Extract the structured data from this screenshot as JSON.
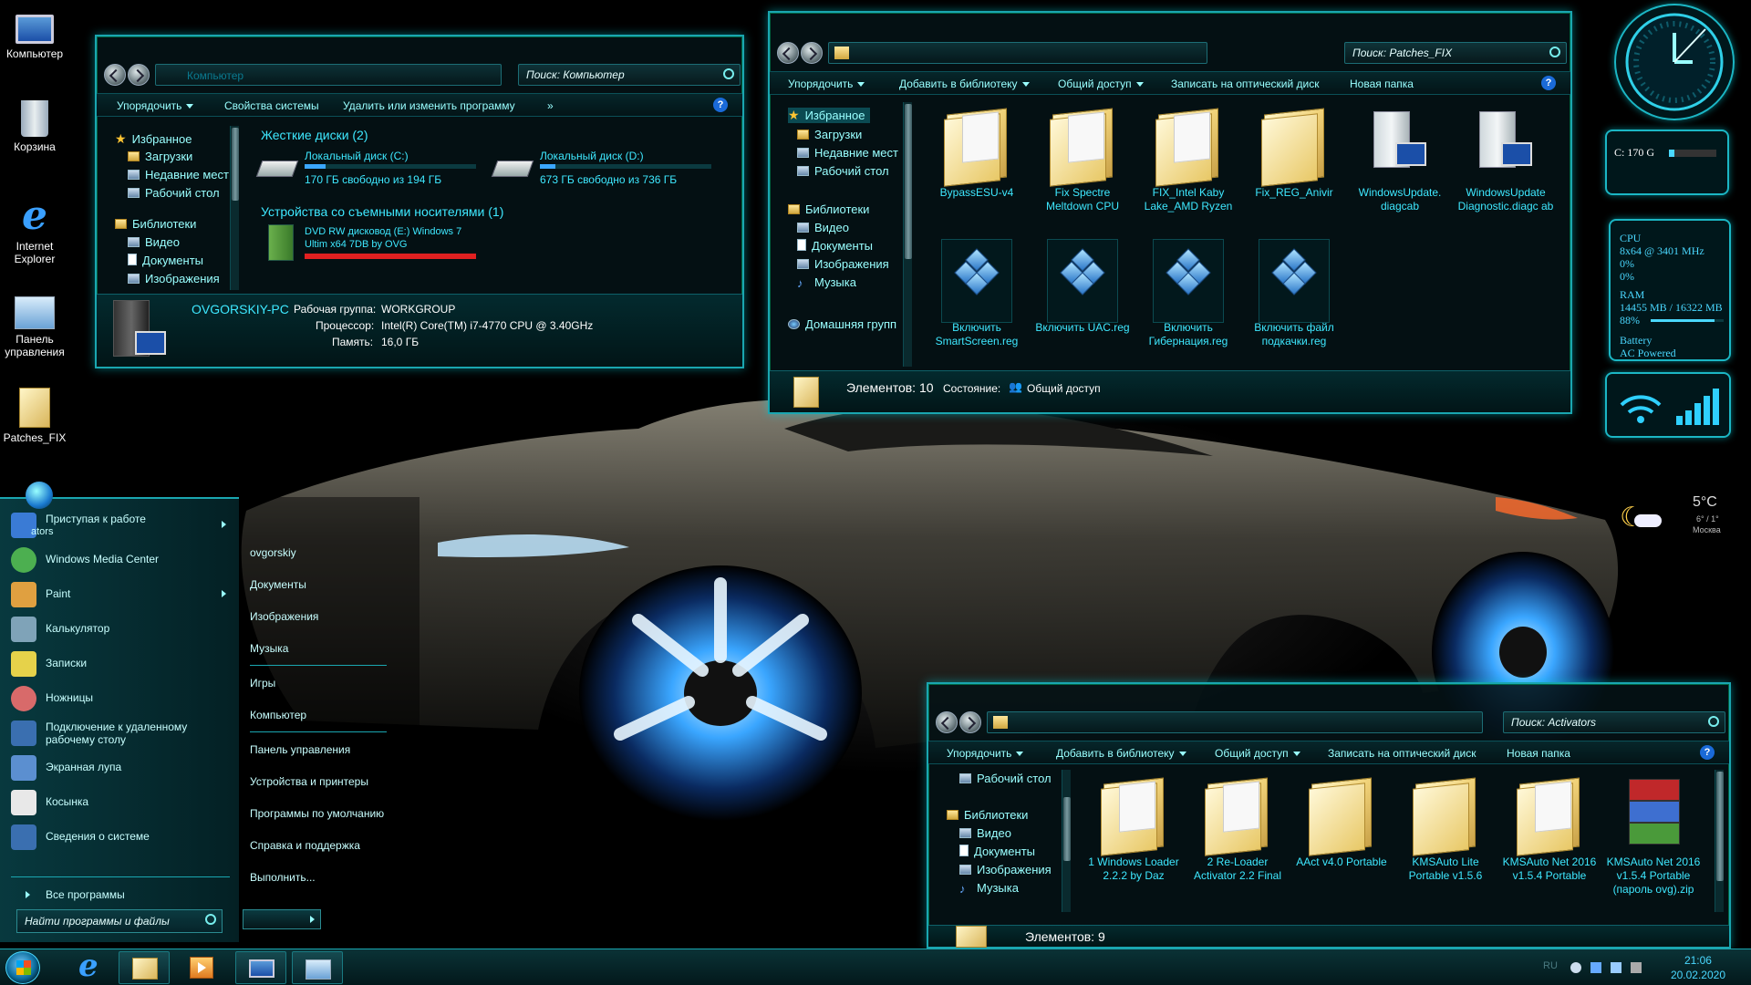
{
  "desktop": {
    "icons": [
      {
        "label": "Компьютер"
      },
      {
        "label": "Корзина"
      },
      {
        "label": "Internet Explorer"
      },
      {
        "label": "Панель управления"
      },
      {
        "label": "Patches_FIX"
      }
    ]
  },
  "computer_window": {
    "address": "Компьютер",
    "search_placeholder": "Поиск: Компьютер",
    "toolbar": {
      "organize": "Упорядочить",
      "system_props": "Свойства системы",
      "uninstall": "Удалить или изменить программу",
      "more": "»"
    },
    "nav": [
      "Избранное",
      "Загрузки",
      "Недавние мест",
      "Рабочий стол",
      "Библиотеки",
      "Видео",
      "Документы",
      "Изображения"
    ],
    "hdd_group": "Жесткие диски (2)",
    "drives": [
      {
        "name": "Локальный диск (C:)",
        "free": "170 ГБ свободно из 194 ГБ",
        "used_fraction": 0.12
      },
      {
        "name": "Локальный диск (D:)",
        "free": "673 ГБ свободно из 736 ГБ",
        "used_fraction": 0.09
      }
    ],
    "removable_group": "Устройства со съемными носителями (1)",
    "dvd": {
      "line1": "DVD RW дисковод (E:) Windows 7",
      "line2": "Ultim x64 7DB by OVG",
      "used_fraction": 1.0
    },
    "details": {
      "pc_name": "OVGORSKIY-PC",
      "workgroup_label": "Рабочая группа:",
      "workgroup": "WORKGROUP",
      "cpu_label": "Процессор:",
      "cpu": "Intel(R) Core(TM) i7-4770 CPU @ 3.40GHz",
      "ram_label": "Память:",
      "ram": "16,0 ГБ"
    }
  },
  "patches_window": {
    "search_placeholder": "Поиск: Patches_FIX",
    "toolbar": {
      "organize": "Упорядочить",
      "add_library": "Добавить в библиотеку",
      "share": "Общий доступ",
      "burn": "Записать на оптический диск",
      "new_folder": "Новая папка"
    },
    "nav": [
      "Избранное",
      "Загрузки",
      "Недавние мест",
      "Рабочий стол",
      "Библиотеки",
      "Видео",
      "Документы",
      "Изображения",
      "Музыка",
      "Домашняя групп"
    ],
    "files": [
      {
        "name": "BypassESU-v4",
        "kind": "folder"
      },
      {
        "name": "Fix Spectre Meltdown CPU",
        "kind": "folder"
      },
      {
        "name": "FIX_Intel Kaby Lake_AMD Ryzen",
        "kind": "folder"
      },
      {
        "name": "Fix_REG_Anivir",
        "kind": "folder"
      },
      {
        "name": "WindowsUpdate. diagcab",
        "kind": "diagcab"
      },
      {
        "name": "WindowsUpdate Diagnostic.diagc ab",
        "kind": "diagcab"
      },
      {
        "name": "Включить SmartScreen.reg",
        "kind": "reg"
      },
      {
        "name": "Включить UAC.reg",
        "kind": "reg"
      },
      {
        "name": "Включить Гибернация.reg",
        "kind": "reg"
      },
      {
        "name": "Включить файл подкачки.reg",
        "kind": "reg"
      }
    ],
    "status": {
      "items": "Элементов: 10",
      "state_label": "Состояние:",
      "state": "Общий доступ"
    }
  },
  "activators_window": {
    "search_placeholder": "Поиск: Activators",
    "toolbar": {
      "organize": "Упорядочить",
      "add_library": "Добавить в библиотеку",
      "share": "Общий доступ",
      "burn": "Записать на оптический диск",
      "new_folder": "Новая папка"
    },
    "nav": [
      "Рабочий стол",
      "Библиотеки",
      "Видео",
      "Документы",
      "Изображения",
      "Музыка"
    ],
    "files": [
      {
        "name": "1 Windows Loader 2.2.2 by Daz",
        "kind": "folder"
      },
      {
        "name": "2 Re-Loader Activator 2.2 Final",
        "kind": "folder"
      },
      {
        "name": "AAct v4.0 Portable",
        "kind": "folder"
      },
      {
        "name": "KMSAuto Lite Portable v1.5.6",
        "kind": "folder"
      },
      {
        "name": "KMSAuto Net 2016 v1.5.4 Portable",
        "kind": "folder"
      },
      {
        "name": "KMSAuto Net 2016 v1.5.4 Portable (пароль ovg).zip",
        "kind": "winrar"
      }
    ],
    "status": {
      "items": "Элементов: 9"
    }
  },
  "start_menu": {
    "programs": [
      {
        "label": "Приступая к работе",
        "sub": "ators",
        "arrow": true,
        "color": "#3a7bd5"
      },
      {
        "label": "Windows Media Center",
        "color": "#4caf50"
      },
      {
        "label": "Paint",
        "arrow": true,
        "color": "#e0a040"
      },
      {
        "label": "Калькулятор",
        "color": "#7fa3b8"
      },
      {
        "label": "Записки",
        "color": "#e6d24a"
      },
      {
        "label": "Ножницы",
        "color": "#d86a6a"
      },
      {
        "label": "Подключение к удаленному",
        "label2": "рабочему столу",
        "color": "#3a6fb0"
      },
      {
        "label": "Экранная лупа",
        "color": "#5b8fd0"
      },
      {
        "label": "Косынка",
        "color": "#e8e8e8"
      },
      {
        "label": "Сведения о системе",
        "color": "#3a6fb0"
      }
    ],
    "all_programs": "Все программы",
    "search_placeholder": "Найти программы и файлы",
    "right_items": [
      "ovgorskiy",
      "Документы",
      "Изображения",
      "Музыка",
      "Игры",
      "Компьютер",
      "Панель управления",
      "Устройства и принтеры",
      "Программы по умолчанию",
      "Справка и поддержка",
      "Выполнить..."
    ]
  },
  "gadgets": {
    "disk": {
      "label": "C: 170 G"
    },
    "cpu": {
      "title": "CPU",
      "freq": "8x64 @ 3401 MHz",
      "core1": "0%",
      "core2": "0%"
    },
    "ram": {
      "title": "RAM",
      "usage": "14455 MB / 16322 MB",
      "percent": "88%",
      "fraction": 0.88
    },
    "battery": {
      "title": "Battery",
      "state": "AC Powered"
    },
    "weather": {
      "temp": "5°C",
      "range": "6° / 1°",
      "city": "Москва"
    }
  },
  "taskbar": {
    "lang": "RU",
    "time": "21:06",
    "date": "20.02.2020"
  },
  "colors": {
    "accent": "#1aa6b0",
    "text_cyan": "#3ee8ff",
    "glow": "#00e0eb"
  }
}
